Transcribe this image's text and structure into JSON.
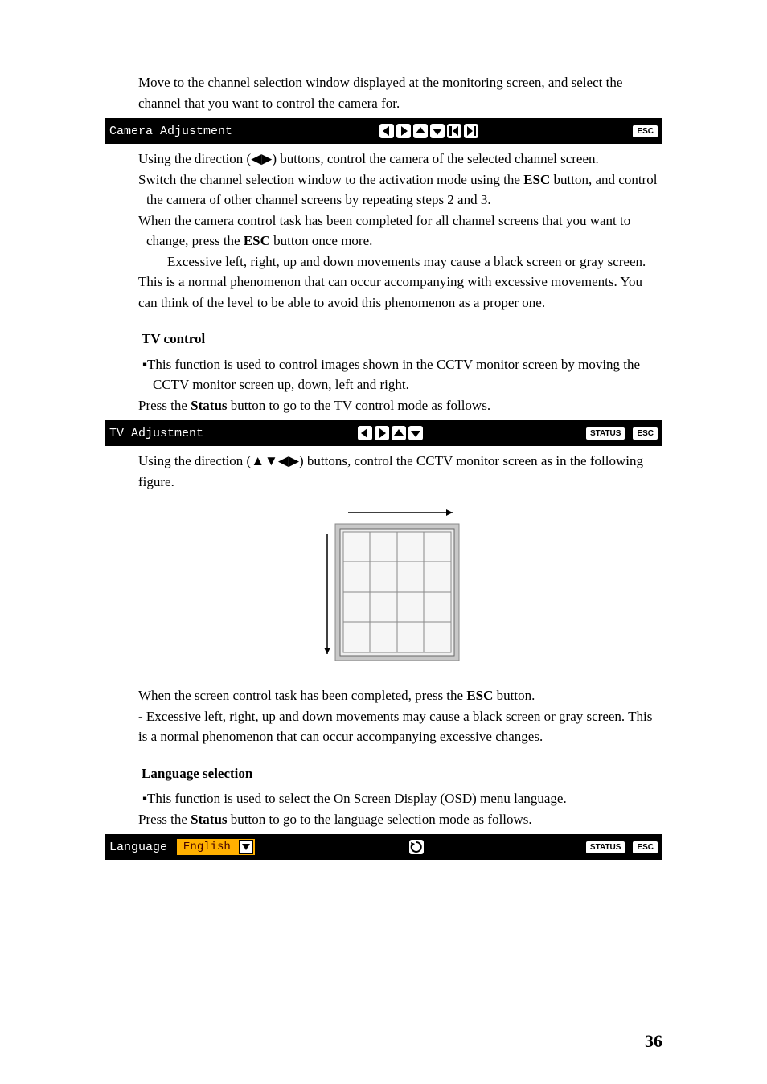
{
  "p1": "Move to the channel selection window displayed at the monitoring screen, and select the channel that you want to control the camera for.",
  "bar1_title": "Camera Adjustment",
  "esc_label": "ESC",
  "status_label": "STATUS",
  "p2a": "Using the direction (◀▶) buttons, control the camera of the selected channel screen.",
  "p2b": "Switch the channel selection window to the activation mode using the ",
  "p2b_bold": "ESC",
  "p2b_end": " button, and control the camera of other channel screens by repeating steps 2 and 3.",
  "p2c": "When the camera control task has been completed for all channel screens that you want to change, press the ",
  "p2c_bold": "ESC",
  "p2c_end": " button once more.",
  "p3": "Excessive left, right, up and down movements may cause a black screen or gray screen. This is a normal phenomenon that can occur accompanying with excessive movements. You can think of the level to be able to avoid this phenomenon as a proper one.",
  "h_tv": "TV control",
  "tv_bullet": "This function is used to control images shown in the CCTV monitor screen by moving the CCTV monitor screen up, down, left and right.",
  "tv_press_a": "Press the ",
  "tv_press_bold": "Status",
  "tv_press_b": " button to go to the TV control mode as follows.",
  "bar2_title": "TV Adjustment",
  "tv_using": "Using the direction (▲▼◀▶) buttons, control the CCTV monitor screen as in the following figure.",
  "tv_done_a": "When the screen control task has been completed, press the ",
  "tv_done_bold": "ESC",
  "tv_done_b": " button.",
  "tv_exc": "- Excessive left, right, up and down movements may cause a black screen or gray screen.    This is a normal phenomenon that can occur accompanying excessive changes.",
  "h_lang": "Language selection",
  "lang_bullet": "This function is used to select the On Screen Display (OSD) menu language.",
  "lang_press_a": "Press the ",
  "lang_press_bold": "Status",
  "lang_press_b": " button to go to the language selection mode as follows.",
  "bar3_title": "Language",
  "dropdown_value": "English",
  "page_number": "36"
}
